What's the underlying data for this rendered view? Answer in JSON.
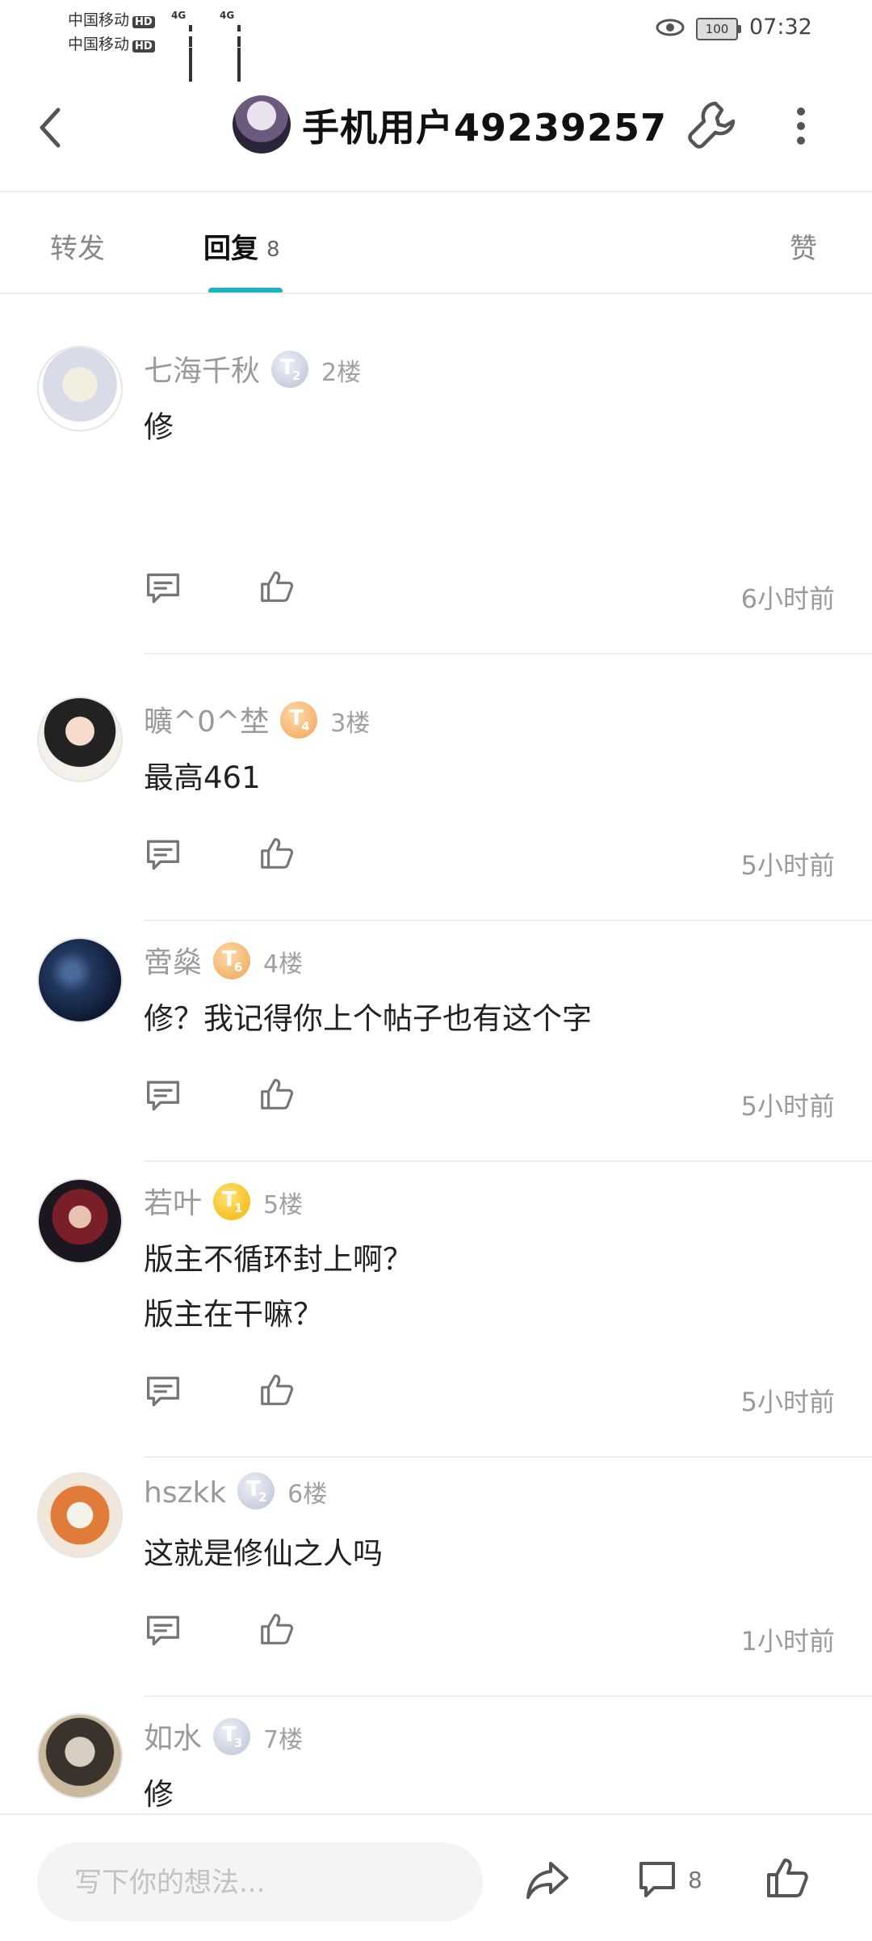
{
  "status_bar": {
    "carrier1": "中国移动",
    "carrier2": "中国移动",
    "hd_label": "HD",
    "network": "4G",
    "battery": "100",
    "time": "07:32"
  },
  "header": {
    "title": "手机用户49239257"
  },
  "tabs": {
    "forward": "转发",
    "reply": "回复",
    "reply_count": "8",
    "like": "赞",
    "active_color": "#1fb1c0"
  },
  "comments": [
    {
      "user": "七海千秋",
      "level": "T",
      "level_num": "2",
      "level_style": "silver",
      "floor": "2楼",
      "lines": [
        "修"
      ],
      "time": "6小时前"
    },
    {
      "user": "曠^0^埜",
      "level": "T",
      "level_num": "4",
      "level_style": "orange",
      "floor": "3楼",
      "lines": [
        "最高461"
      ],
      "time": "5小时前"
    },
    {
      "user": "啻燊",
      "level": "T",
      "level_num": "6",
      "level_style": "orange",
      "floor": "4楼",
      "lines": [
        "修？我记得你上个帖子也有这个字"
      ],
      "time": "5小时前"
    },
    {
      "user": "若叶",
      "level": "T",
      "level_num": "1",
      "level_style": "gold",
      "floor": "5楼",
      "lines": [
        "版主不循环封上啊？",
        "版主在干嘛？"
      ],
      "time": "5小时前"
    },
    {
      "user": "hszkk",
      "level": "T",
      "level_num": "2",
      "level_style": "silver",
      "floor": "6楼",
      "lines": [
        "这就是修仙之人吗"
      ],
      "time": "1小时前"
    },
    {
      "user": "如水",
      "level": "T",
      "level_num": "3",
      "level_style": "silver",
      "floor": "7楼",
      "lines": [
        "修"
      ],
      "time": ""
    }
  ],
  "bottom_bar": {
    "placeholder": "写下你的想法...",
    "comment_count": "8"
  }
}
